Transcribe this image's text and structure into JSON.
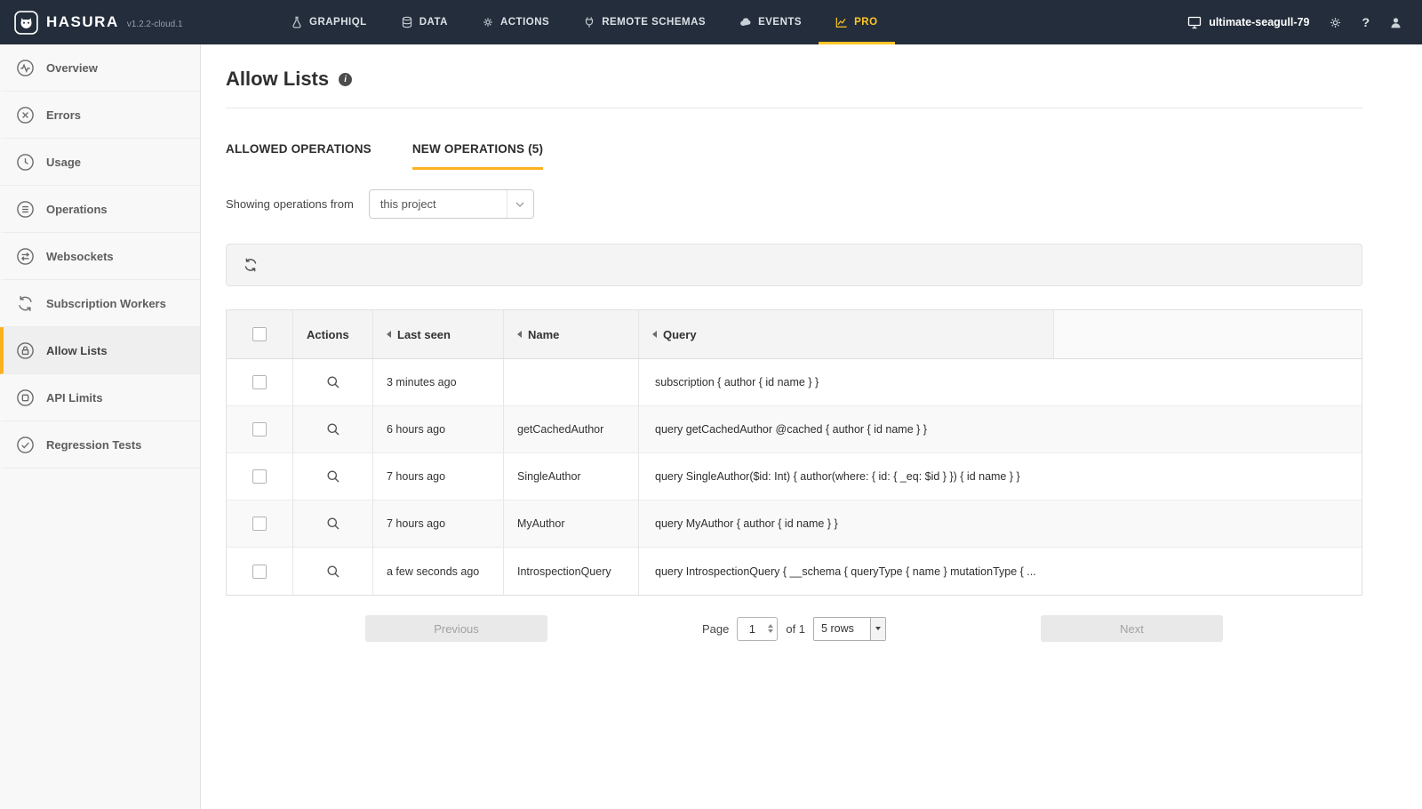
{
  "colors": {
    "navbar_bg": "#232d3b",
    "accent_yellow": "#ffc627",
    "accent_orange": "#fcb21f"
  },
  "navbar": {
    "brand": "HASURA",
    "version": "v1.2.2-cloud.1",
    "items": [
      {
        "label": "GRAPHIQL",
        "icon": "flask-icon"
      },
      {
        "label": "DATA",
        "icon": "database-icon"
      },
      {
        "label": "ACTIONS",
        "icon": "gears-icon"
      },
      {
        "label": "REMOTE SCHEMAS",
        "icon": "plug-icon"
      },
      {
        "label": "EVENTS",
        "icon": "cloud-icon"
      },
      {
        "label": "PRO",
        "icon": "line-chart-icon",
        "active": true
      }
    ],
    "project_name": "ultimate-seagull-79",
    "help_label": "?"
  },
  "sidebar": {
    "items": [
      {
        "label": "Overview",
        "icon": "pulse-icon"
      },
      {
        "label": "Errors",
        "icon": "error-circle-icon"
      },
      {
        "label": "Usage",
        "icon": "clock-icon"
      },
      {
        "label": "Operations",
        "icon": "list-circle-icon"
      },
      {
        "label": "Websockets",
        "icon": "arrows-exchange-icon"
      },
      {
        "label": "Subscription Workers",
        "icon": "sync-icon"
      },
      {
        "label": "Allow Lists",
        "icon": "lock-circle-icon",
        "active": true
      },
      {
        "label": "API Limits",
        "icon": "square-circle-icon"
      },
      {
        "label": "Regression Tests",
        "icon": "check-circle-icon"
      }
    ]
  },
  "page": {
    "title": "Allow Lists",
    "tabs": [
      {
        "label": "ALLOWED OPERATIONS",
        "active": false
      },
      {
        "label": "NEW OPERATIONS (5)",
        "active": true
      }
    ],
    "filter": {
      "label": "Showing operations from",
      "selected": "this project"
    },
    "table": {
      "headers": {
        "actions": "Actions",
        "last_seen": "Last seen",
        "name": "Name",
        "query": "Query"
      },
      "rows": [
        {
          "last_seen": "3 minutes ago",
          "name": "",
          "query": "subscription { author { id name } }"
        },
        {
          "last_seen": "6 hours ago",
          "name": "getCachedAuthor",
          "query": "query getCachedAuthor @cached { author { id name } }"
        },
        {
          "last_seen": "7 hours ago",
          "name": "SingleAuthor",
          "query": "query SingleAuthor($id: Int) { author(where: { id: { _eq: $id } }) { id name } }"
        },
        {
          "last_seen": "7 hours ago",
          "name": "MyAuthor",
          "query": "query MyAuthor { author { id name } }"
        },
        {
          "last_seen": "a few seconds ago",
          "name": "IntrospectionQuery",
          "query": "query IntrospectionQuery { __schema { queryType { name } mutationType { ..."
        }
      ]
    },
    "pagination": {
      "previous": "Previous",
      "next": "Next",
      "page_label": "Page",
      "page_value": "1",
      "of_label": "of 1",
      "rows_per_page": "5 rows"
    }
  }
}
